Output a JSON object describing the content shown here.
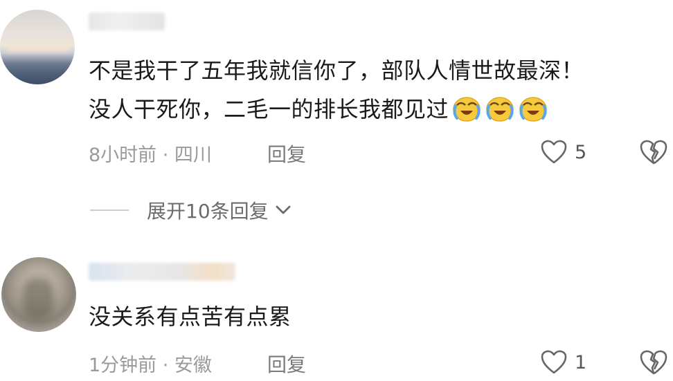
{
  "comments": [
    {
      "text_lines": [
        "不是我干了五年我就信你了，部队人情世故最深！",
        "没人干死你，二毛一的排长我都见过"
      ],
      "emoji": [
        "crying-laughing-emoji",
        "crying-laughing-emoji",
        "crying-laughing-emoji"
      ],
      "meta": "8小时前 · 四川",
      "reply_label": "回复",
      "like_count": "5",
      "expand_replies": "展开10条回复"
    },
    {
      "text_lines": [
        "没关系有点苦有点累"
      ],
      "meta": "1分钟前 · 安徽",
      "reply_label": "回复",
      "like_count": "1"
    }
  ],
  "colors": {
    "text": "#1a1a1a",
    "meta": "#9a9a9a",
    "icon": "#666666",
    "emoji_face": "#f7c93c"
  }
}
